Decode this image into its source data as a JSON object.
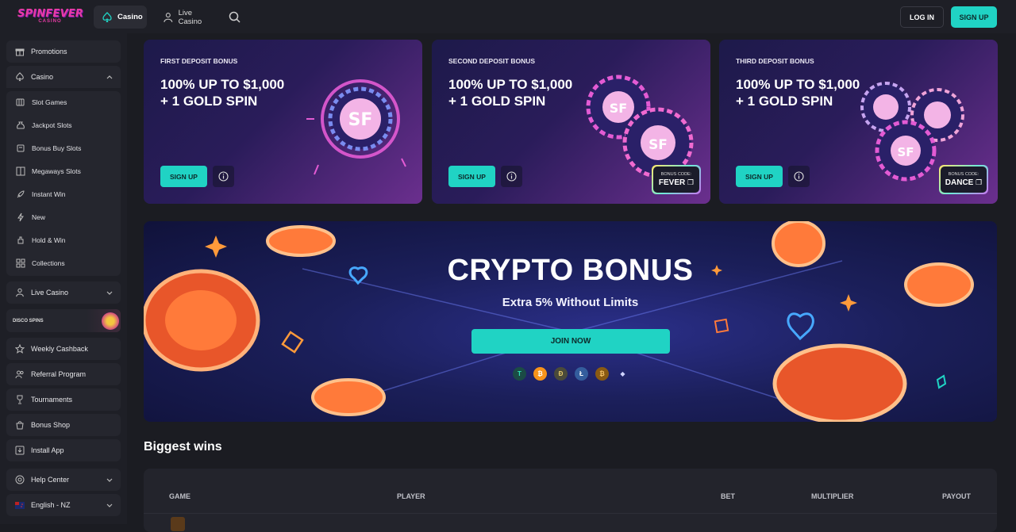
{
  "header": {
    "logo_line1": "SPINFEVER",
    "logo_line2": "CASINO",
    "nav": [
      {
        "label": "Casino",
        "icon": "spade-icon"
      },
      {
        "label": "Live Casino",
        "icon": "dealer-icon"
      }
    ],
    "login_label": "LOG IN",
    "signup_label": "SIGN UP"
  },
  "sidebar": {
    "promotions": "Promotions",
    "casino": "Casino",
    "casino_items": [
      {
        "label": "Slot Games",
        "icon": "slot-icon"
      },
      {
        "label": "Jackpot Slots",
        "icon": "bag-icon"
      },
      {
        "label": "Bonus Buy Slots",
        "icon": "cart-icon"
      },
      {
        "label": "Megaways Slots",
        "icon": "grid-icon"
      },
      {
        "label": "Instant Win",
        "icon": "rocket-icon"
      },
      {
        "label": "New",
        "icon": "bolt-icon"
      },
      {
        "label": "Hold & Win",
        "icon": "hand-icon"
      },
      {
        "label": "Collections",
        "icon": "collections-icon"
      }
    ],
    "live_casino": "Live Casino",
    "disco_spins": "DISCO SPINS",
    "weekly_cashback": "Weekly Cashback",
    "referral_program": "Referral Program",
    "tournaments": "Tournaments",
    "bonus_shop": "Bonus Shop",
    "install_app": "Install App",
    "help_center": "Help Center",
    "language": "English - NZ"
  },
  "bonus_cards": [
    {
      "title": "FIRST DEPOSIT BONUS",
      "line1": "100% UP TO $1,000",
      "line2": "+ 1 GOLD SPIN",
      "button": "SIGN UP",
      "code_label": "",
      "code": ""
    },
    {
      "title": "SECOND DEPOSIT BONUS",
      "line1": "100% UP TO $1,000",
      "line2": "+ 1 GOLD SPIN",
      "button": "SIGN UP",
      "code_label": "BONUS CODE:",
      "code": "FEVER"
    },
    {
      "title": "THIRD DEPOSIT BONUS",
      "line1": "100% UP TO $1,000",
      "line2": "+ 1 GOLD SPIN",
      "button": "SIGN UP",
      "code_label": "BONUS CODE:",
      "code": "DANCE"
    }
  ],
  "crypto": {
    "title": "CRYPTO BONUS",
    "subtitle": "Extra 5% Without Limits",
    "button": "JOIN NOW",
    "coins": [
      {
        "symbol": "T",
        "name": "tether-icon",
        "color": "#1b4b45"
      },
      {
        "symbol": "₿",
        "name": "bitcoin-icon",
        "color": "#f7931a"
      },
      {
        "symbol": "Ð",
        "name": "dogecoin-icon",
        "color": "#4a4a3a"
      },
      {
        "symbol": "Ł",
        "name": "litecoin-icon",
        "color": "#345d9d"
      },
      {
        "symbol": "₿",
        "name": "bitcoin-cash-icon",
        "color": "#8a5a12"
      },
      {
        "symbol": "◆",
        "name": "ethereum-icon",
        "color": "transparent"
      }
    ]
  },
  "biggest_wins": {
    "title": "Biggest wins",
    "columns": [
      "GAME",
      "PLAYER",
      "BET",
      "MULTIPLIER",
      "PAYOUT"
    ]
  }
}
